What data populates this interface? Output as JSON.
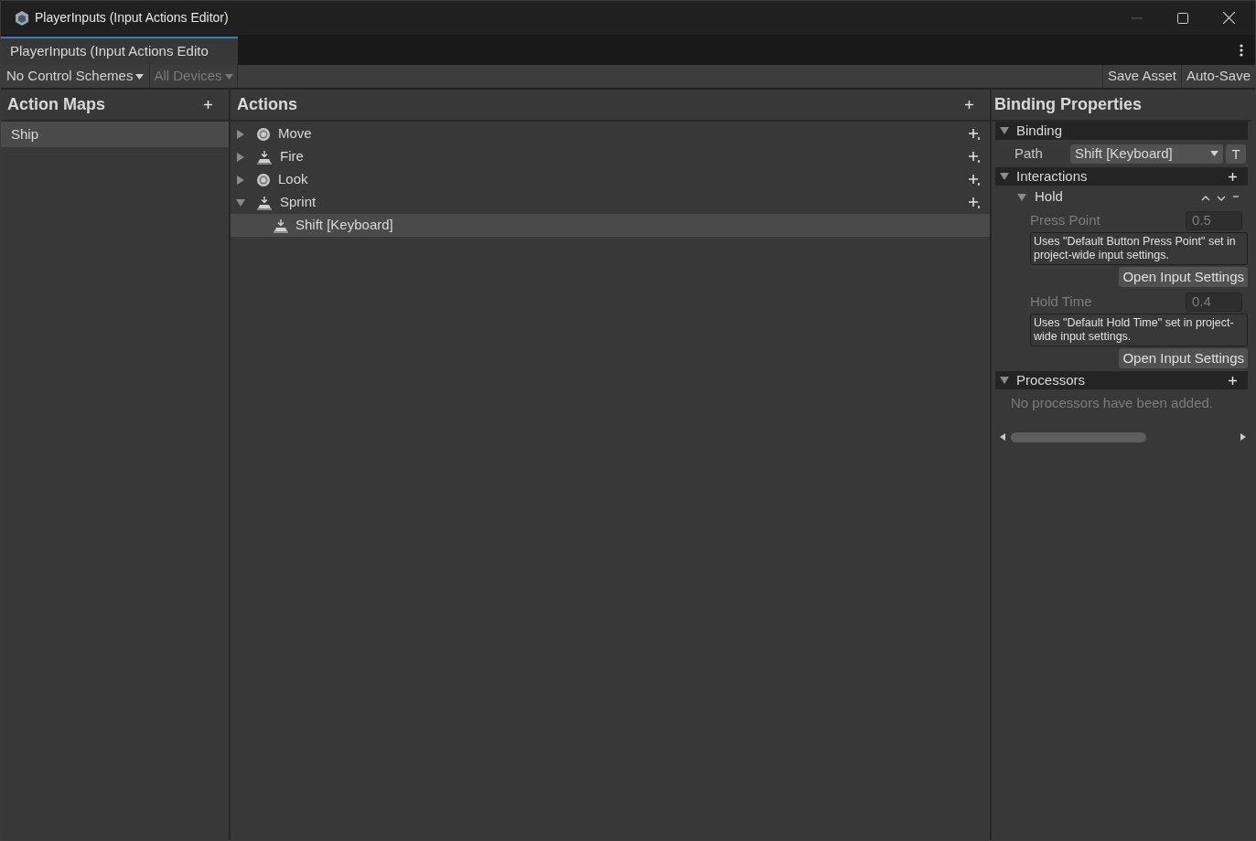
{
  "window": {
    "title": "PlayerInputs (Input Actions Editor)"
  },
  "tabs": [
    {
      "label": "PlayerInputs (Input Actions Edito",
      "selected": true
    }
  ],
  "toolbar": {
    "control_scheme": "No Control Schemes",
    "devices": {
      "label": "All Devices",
      "disabled": true
    },
    "buttons": [
      "Save Asset",
      "Auto-Save"
    ]
  },
  "action_maps": {
    "title": "Action Maps",
    "items": [
      {
        "label": "Ship",
        "selected": true
      }
    ]
  },
  "actions": {
    "title": "Actions",
    "items": [
      {
        "label": "Move",
        "kind": "value",
        "expanded": false,
        "selected": false
      },
      {
        "label": "Fire",
        "kind": "button",
        "expanded": false,
        "selected": false
      },
      {
        "label": "Look",
        "kind": "value",
        "expanded": false,
        "selected": false
      },
      {
        "label": "Sprint",
        "kind": "button",
        "expanded": true,
        "selected": false,
        "children": [
          {
            "label": "Shift [Keyboard]",
            "selected": true
          }
        ]
      }
    ]
  },
  "binding_properties": {
    "title": "Binding Properties",
    "binding": {
      "title": "Binding",
      "expanded": true,
      "path_label": "Path",
      "path_value": "Shift [Keyboard]",
      "t_button": "T"
    },
    "interactions": {
      "title": "Interactions",
      "expanded": true,
      "items": [
        {
          "title": "Hold",
          "expanded": true,
          "params": [
            {
              "label": "Press Point",
              "value": "0.5",
              "note": "Uses \"Default Button Press Point\" set in project-wide input settings.",
              "button": "Open Input Settings"
            },
            {
              "label": "Hold Time",
              "value": "0.4",
              "note": "Uses \"Default Hold Time\" set in project-wide input settings.",
              "button": "Open Input Settings"
            }
          ]
        }
      ]
    },
    "processors": {
      "title": "Processors",
      "expanded": true,
      "empty_text": "No processors have been added."
    }
  }
}
